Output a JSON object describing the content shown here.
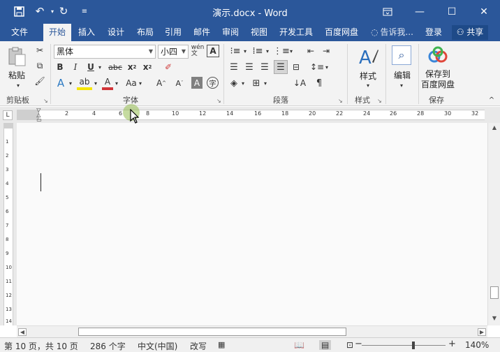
{
  "titlebar": {
    "title": "演示.docx - Word",
    "quick_access": {
      "save_icon": "save-icon",
      "undo_icon": "undo-icon",
      "redo_icon": "redo-icon",
      "customize_icon": "customize-icon"
    },
    "buttons": {
      "ribbon_display": "ribbon-display-icon",
      "minimize": "minimize-icon",
      "maximize": "maximize-icon",
      "close": "close-icon"
    }
  },
  "tabs": [
    {
      "label": "文件"
    },
    {
      "label": "开始"
    },
    {
      "label": "插入"
    },
    {
      "label": "设计"
    },
    {
      "label": "布局"
    },
    {
      "label": "引用"
    },
    {
      "label": "邮件"
    },
    {
      "label": "审阅"
    },
    {
      "label": "视图"
    },
    {
      "label": "开发工具"
    },
    {
      "label": "百度网盘"
    }
  ],
  "active_tab": "开始",
  "tell_me": "告诉我...",
  "login": "登录",
  "share": "共享",
  "ribbon": {
    "clipboard": {
      "paste": "粘贴",
      "group": "剪贴板"
    },
    "font": {
      "name": "黑体",
      "size": "小四",
      "group": "字体"
    },
    "paragraph": {
      "group": "段落"
    },
    "styles": {
      "button": "样式",
      "group": "样式"
    },
    "editing": {
      "button": "编辑"
    },
    "save": {
      "button_line1": "保存到",
      "button_line2": "百度网盘",
      "group": "保存"
    }
  },
  "ruler": {
    "corner": "L",
    "numbers": [
      "2",
      "4",
      "6",
      "8",
      "10",
      "12",
      "14",
      "16",
      "18",
      "20",
      "22",
      "24",
      "26",
      "28",
      "30",
      "32"
    ],
    "vertical_numbers": [
      "1",
      "2",
      "3",
      "4",
      "5",
      "6",
      "7",
      "8",
      "9",
      "10",
      "11",
      "12",
      "13",
      "14"
    ]
  },
  "status": {
    "page": "第 10 页，共 10 页",
    "words": "286 个字",
    "language": "中文(中国)",
    "mode": "改写",
    "zoom": "140%"
  },
  "colors": {
    "accent": "#2b579a",
    "ribbon_bg": "#f3f3f3"
  }
}
